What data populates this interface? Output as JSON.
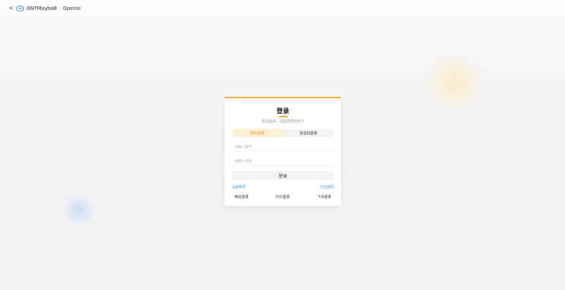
{
  "topbar": {
    "back_glyph": "<",
    "app_name": "ONTMaybeB",
    "separator": "-",
    "section": "Openai"
  },
  "login": {
    "title": "登录",
    "subtitle": "欢迎回来，请登录您的账户",
    "tabs": [
      {
        "label": "密码登录",
        "active": true
      },
      {
        "label": "验证码登录",
        "active": false
      }
    ],
    "username_placeholder": "请输入账号",
    "password_placeholder": "请输入密码",
    "submit_label": "登录",
    "register_link": "注册账号",
    "forgot_link": "忘记密码",
    "third_party": [
      "微信登录",
      "钉钉登录",
      "飞书登录"
    ]
  },
  "colors": {
    "accent": "#f2a93b",
    "link": "#4a8fd6"
  }
}
